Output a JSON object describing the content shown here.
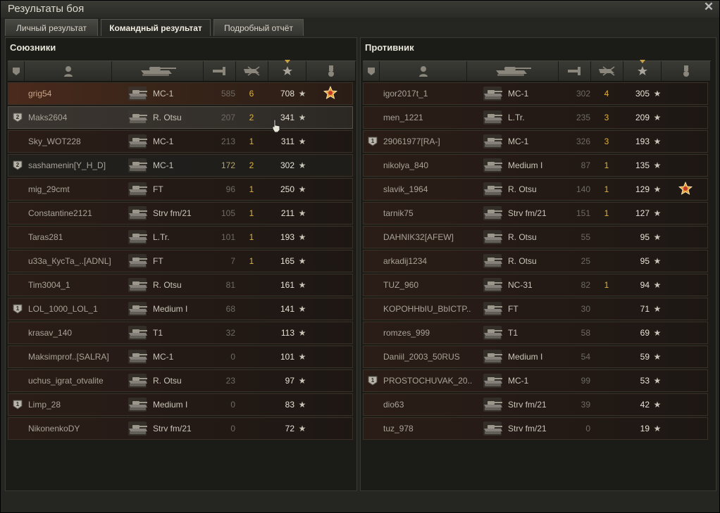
{
  "window": {
    "title": "Результаты боя",
    "close_label": "✕"
  },
  "tabs": [
    {
      "label": "Личный результат",
      "active": false
    },
    {
      "label": "Командный результат",
      "active": true
    },
    {
      "label": "Подробный отчёт",
      "active": false
    }
  ],
  "allies": {
    "title": "Союзники",
    "rows": [
      {
        "platoon": "",
        "name": "grig54",
        "tank": "MC-1",
        "damage": "585",
        "kills": "6",
        "xp": "708",
        "medal": "order-icon",
        "style": "self"
      },
      {
        "platoon": "2",
        "name": "Maks2604",
        "tank": "R. Otsu",
        "damage": "207",
        "kills": "2",
        "xp": "341",
        "medal": "",
        "style": "hover"
      },
      {
        "platoon": "",
        "name": "Sky_WOT228",
        "tank": "MC-1",
        "damage": "213",
        "kills": "1",
        "xp": "311",
        "medal": "",
        "style": ""
      },
      {
        "platoon": "2",
        "name": "sashamenin[Y_H_D]",
        "tank": "MC-1",
        "damage": "172",
        "kills": "2",
        "xp": "302",
        "medal": "",
        "style": "dark",
        "dmg_hi": true
      },
      {
        "platoon": "",
        "name": "mig_29cmt",
        "tank": "FT",
        "damage": "96",
        "kills": "1",
        "xp": "250",
        "medal": "",
        "style": ""
      },
      {
        "platoon": "",
        "name": "Constantine2121",
        "tank": "Strv fm/21",
        "damage": "105",
        "kills": "1",
        "xp": "211",
        "medal": "",
        "style": ""
      },
      {
        "platoon": "",
        "name": "Taras281",
        "tank": "L.Tr.",
        "damage": "101",
        "kills": "1",
        "xp": "193",
        "medal": "",
        "style": ""
      },
      {
        "platoon": "",
        "name": "u33a_КусТа_..[ADNL]",
        "tank": "FT",
        "damage": "7",
        "kills": "1",
        "xp": "165",
        "medal": "",
        "style": ""
      },
      {
        "platoon": "",
        "name": "Tim3004_1",
        "tank": "R. Otsu",
        "damage": "81",
        "kills": "",
        "xp": "161",
        "medal": "",
        "style": ""
      },
      {
        "platoon": "1",
        "name": "LOL_1000_LOL_1",
        "tank": "Medium I",
        "damage": "68",
        "kills": "",
        "xp": "141",
        "medal": "",
        "style": ""
      },
      {
        "platoon": "",
        "name": "krasav_140",
        "tank": "T1",
        "damage": "32",
        "kills": "",
        "xp": "113",
        "medal": "",
        "style": ""
      },
      {
        "platoon": "",
        "name": "Maksimprof..[SALRA]",
        "tank": "MC-1",
        "damage": "0",
        "kills": "",
        "xp": "101",
        "medal": "",
        "style": ""
      },
      {
        "platoon": "",
        "name": "uchus_igrat_otvalite",
        "tank": "R. Otsu",
        "damage": "23",
        "kills": "",
        "xp": "97",
        "medal": "",
        "style": ""
      },
      {
        "platoon": "1",
        "name": "Limp_28",
        "tank": "Medium I",
        "damage": "0",
        "kills": "",
        "xp": "83",
        "medal": "",
        "style": ""
      },
      {
        "platoon": "",
        "name": "NikonenkoDY",
        "tank": "Strv fm/21",
        "damage": "0",
        "kills": "",
        "xp": "72",
        "medal": "",
        "style": ""
      }
    ]
  },
  "enemies": {
    "title": "Противник",
    "rows": [
      {
        "platoon": "",
        "name": "igor2017t_1",
        "tank": "MC-1",
        "damage": "302",
        "kills": "4",
        "xp": "305",
        "medal": "",
        "style": ""
      },
      {
        "platoon": "",
        "name": "men_1221",
        "tank": "L.Tr.",
        "damage": "235",
        "kills": "3",
        "xp": "209",
        "medal": "",
        "style": ""
      },
      {
        "platoon": "1",
        "name": "29061977[RA-]",
        "tank": "MC-1",
        "damage": "326",
        "kills": "3",
        "xp": "193",
        "medal": "",
        "style": ""
      },
      {
        "platoon": "",
        "name": "nikolya_840",
        "tank": "Medium I",
        "damage": "87",
        "kills": "1",
        "xp": "135",
        "medal": "",
        "style": ""
      },
      {
        "platoon": "",
        "name": "slavik_1964",
        "tank": "R. Otsu",
        "damage": "140",
        "kills": "1",
        "xp": "129",
        "medal": "order-icon",
        "style": ""
      },
      {
        "platoon": "",
        "name": "tarnik75",
        "tank": "Strv fm/21",
        "damage": "151",
        "kills": "1",
        "xp": "127",
        "medal": "",
        "style": ""
      },
      {
        "platoon": "",
        "name": "DAHNIK32[AFEW]",
        "tank": "R. Otsu",
        "damage": "55",
        "kills": "",
        "xp": "95",
        "medal": "",
        "style": ""
      },
      {
        "platoon": "",
        "name": "arkadij1234",
        "tank": "R. Otsu",
        "damage": "25",
        "kills": "",
        "xp": "95",
        "medal": "",
        "style": ""
      },
      {
        "platoon": "",
        "name": "TUZ_960",
        "tank": "NC-31",
        "damage": "82",
        "kills": "1",
        "xp": "94",
        "medal": "",
        "style": ""
      },
      {
        "platoon": "",
        "name": "KOPOHHbIU_BbICTP..",
        "tank": "FT",
        "damage": "30",
        "kills": "",
        "xp": "71",
        "medal": "",
        "style": ""
      },
      {
        "platoon": "",
        "name": "romzes_999",
        "tank": "T1",
        "damage": "58",
        "kills": "",
        "xp": "69",
        "medal": "",
        "style": ""
      },
      {
        "platoon": "",
        "name": "Daniil_2003_50RUS",
        "tank": "Medium I",
        "damage": "54",
        "kills": "",
        "xp": "59",
        "medal": "",
        "style": ""
      },
      {
        "platoon": "1",
        "name": "PROSTOCHUVAK_20..",
        "tank": "MC-1",
        "damage": "99",
        "kills": "",
        "xp": "53",
        "medal": "",
        "style": ""
      },
      {
        "platoon": "",
        "name": "dio63",
        "tank": "Strv fm/21",
        "damage": "39",
        "kills": "",
        "xp": "42",
        "medal": "",
        "style": ""
      },
      {
        "platoon": "",
        "name": "tuz_978",
        "tank": "Strv fm/21",
        "damage": "0",
        "kills": "",
        "xp": "19",
        "medal": "",
        "style": ""
      }
    ]
  },
  "columns": [
    {
      "icon": "squad-icon"
    },
    {
      "icon": "player-icon"
    },
    {
      "icon": "tank-icon"
    },
    {
      "icon": "damage-icon"
    },
    {
      "icon": "kills-icon"
    },
    {
      "icon": "xp-star-icon",
      "sorted": true
    },
    {
      "icon": "medal-icon"
    }
  ],
  "colors": {
    "kills": "#e2b23a",
    "self_row": "#4a2a1c",
    "medal": "#e8a33a"
  }
}
